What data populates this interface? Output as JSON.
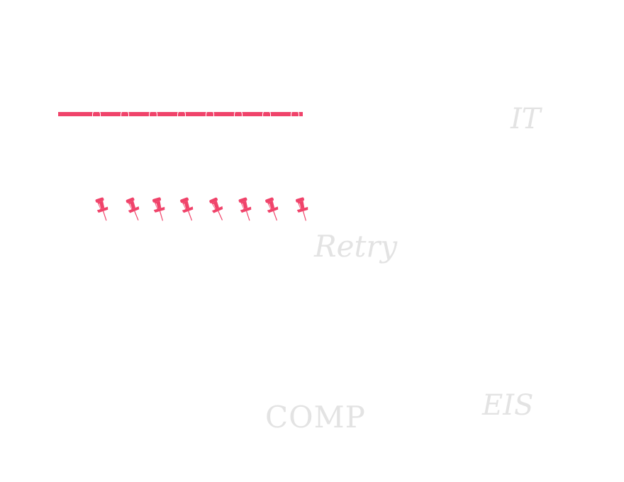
{
  "colors": {
    "accent": "#f0436a",
    "word": "#e3e3e3"
  },
  "notebook": {
    "ring_count": 8,
    "ring_icon": "binder-ring-icon"
  },
  "pins": {
    "count": 8,
    "icon": "pushpin-icon"
  },
  "words": {
    "it": "IT",
    "retry": "Retry",
    "comp": "COMP",
    "eis": "EIS"
  }
}
